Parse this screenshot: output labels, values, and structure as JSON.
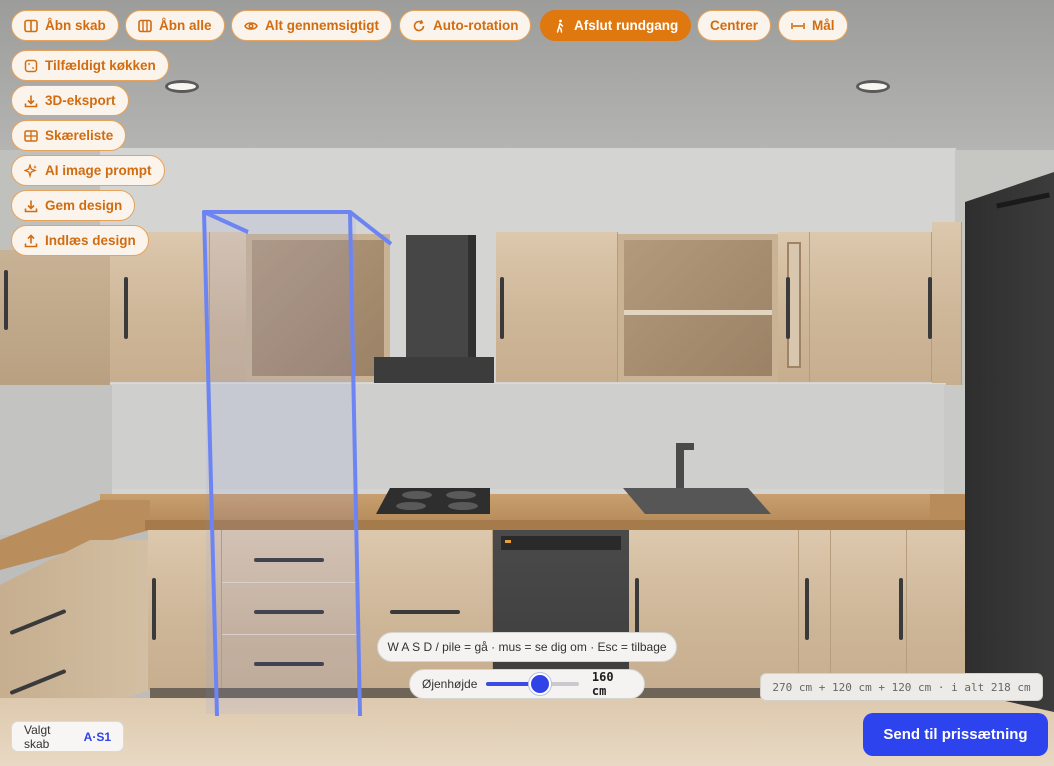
{
  "toolbar": {
    "row": [
      {
        "id": "open-cabinet",
        "label": "Åbn skab",
        "icon": "cabinet-open-icon",
        "active": false
      },
      {
        "id": "open-all",
        "label": "Åbn alle",
        "icon": "columns-icon",
        "active": false
      },
      {
        "id": "all-transparent",
        "label": "Alt gennemsigtigt",
        "icon": "eye-icon",
        "active": false
      },
      {
        "id": "auto-rotation",
        "label": "Auto-rotation",
        "icon": "rotate-icon",
        "active": false
      },
      {
        "id": "end-tour",
        "label": "Afslut rundgang",
        "icon": "walking-person-icon",
        "active": true
      },
      {
        "id": "center",
        "label": "Centrer",
        "icon": null,
        "active": false
      },
      {
        "id": "measure",
        "label": "Mål",
        "icon": "ruler-arrows-icon",
        "active": false
      }
    ],
    "column": [
      {
        "id": "random-kitchen",
        "label": "Tilfældigt køkken",
        "icon": "dice-icon"
      },
      {
        "id": "export-3d",
        "label": "3D-eksport",
        "icon": "download-icon"
      },
      {
        "id": "cut-list",
        "label": "Skæreliste",
        "icon": "table-icon"
      },
      {
        "id": "ai-image-prompt",
        "label": "AI image prompt",
        "icon": "sparkle-icon"
      },
      {
        "id": "save-design",
        "label": "Gem design",
        "icon": "download-icon"
      },
      {
        "id": "load-design",
        "label": "Indlæs design",
        "icon": "upload-icon"
      }
    ]
  },
  "walk_hint": "W A S D / pile = gå · mus = se dig om · Esc = tilbage",
  "eye_height": {
    "label": "Øjenhøjde",
    "value_text": "160 cm",
    "value": 160,
    "fraction": 0.58
  },
  "dimensions_text": "270 cm + 120 cm + 120 cm · i alt 218 cm",
  "selected_cabinet": {
    "label": "Valgt skab",
    "value": "A·S1"
  },
  "send_button": "Send til prissætning",
  "colors": {
    "accent_orange": "#e07810",
    "button_blue": "#2d43ee",
    "selection_outline": "#6b84f2"
  }
}
